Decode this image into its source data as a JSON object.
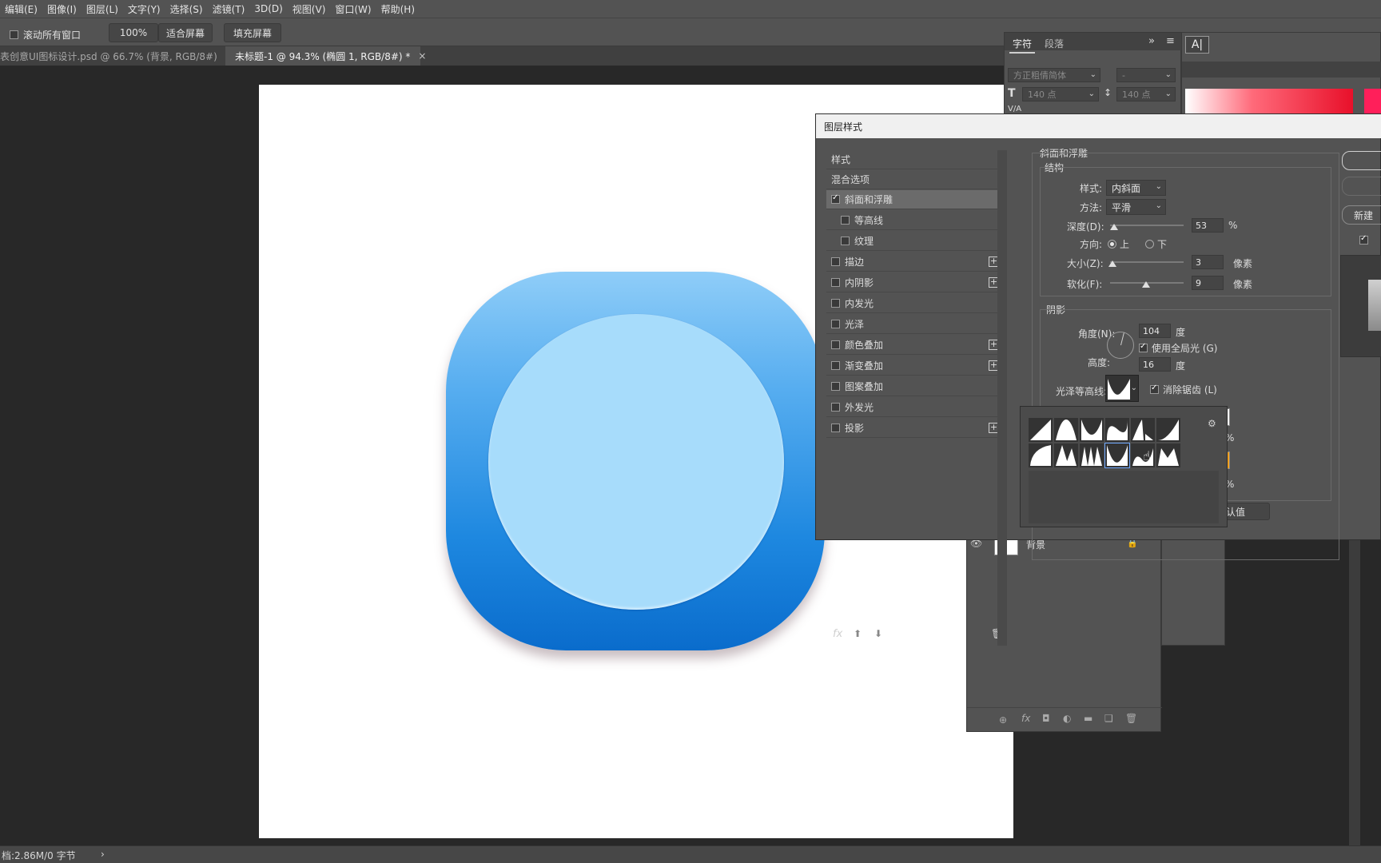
{
  "menu": [
    "编辑(E)",
    "图像(I)",
    "图层(L)",
    "文字(Y)",
    "选择(S)",
    "滤镜(T)",
    "3D(D)",
    "视图(V)",
    "窗口(W)",
    "帮助(H)"
  ],
  "options": {
    "scroll_all_label": "滚动所有窗口",
    "zoom_value": "100%",
    "fit_screen": "适合屏幕",
    "fill_screen": "填充屏幕"
  },
  "tabs": [
    {
      "label": "表创意UI图标设计.psd @ 66.7% (背景, RGB/8#)",
      "close": "×"
    },
    {
      "label": "未标题-1 @ 94.3% (椭圆 1, RGB/8#) *",
      "close": "×"
    }
  ],
  "status": {
    "doc_size": "档:2.86M/0 字节",
    "arrow": "›"
  },
  "char_panel": {
    "tab_char": "字符",
    "tab_para": "段落",
    "expand": "»",
    "menu": "≡",
    "font_family": "方正粗倩简体",
    "font_style": "-",
    "font_size": "140 点",
    "leading": "140 点",
    "kerning_label": "V/A"
  },
  "layers_panel": {
    "bg_layer_name": "背景",
    "footer_icons": [
      "link-icon",
      "fx-icon",
      "mask-icon",
      "adjustment-icon",
      "folder-icon",
      "new-layer-icon",
      "trash-icon"
    ]
  },
  "dialog": {
    "title": "图层样式",
    "styles_header": "样式",
    "blend_options": "混合选项",
    "style_items": [
      {
        "label": "斜面和浮雕",
        "checked": true,
        "selected": true,
        "plus": false,
        "indent": false
      },
      {
        "label": "等高线",
        "checked": false,
        "selected": false,
        "plus": false,
        "indent": true
      },
      {
        "label": "纹理",
        "checked": false,
        "selected": false,
        "plus": false,
        "indent": true
      },
      {
        "label": "描边",
        "checked": false,
        "selected": false,
        "plus": true,
        "indent": false
      },
      {
        "label": "内阴影",
        "checked": false,
        "selected": false,
        "plus": true,
        "indent": false
      },
      {
        "label": "内发光",
        "checked": false,
        "selected": false,
        "plus": false,
        "indent": false
      },
      {
        "label": "光泽",
        "checked": false,
        "selected": false,
        "plus": false,
        "indent": false
      },
      {
        "label": "颜色叠加",
        "checked": false,
        "selected": false,
        "plus": true,
        "indent": false
      },
      {
        "label": "渐变叠加",
        "checked": false,
        "selected": false,
        "plus": true,
        "indent": false
      },
      {
        "label": "图案叠加",
        "checked": false,
        "selected": false,
        "plus": false,
        "indent": false
      },
      {
        "label": "外发光",
        "checked": false,
        "selected": false,
        "plus": false,
        "indent": false
      },
      {
        "label": "投影",
        "checked": false,
        "selected": false,
        "plus": true,
        "indent": false
      }
    ],
    "fx_label": "fx",
    "bevel": {
      "section_title": "斜面和浮雕",
      "structure_title": "结构",
      "style_label": "样式:",
      "style_value": "内斜面",
      "technique_label": "方法:",
      "technique_value": "平滑",
      "depth_label": "深度(D):",
      "depth_value": "53",
      "depth_unit": "%",
      "depth_fraction": 0.05,
      "direction_label": "方向:",
      "dir_up": "上",
      "dir_down": "下",
      "size_label": "大小(Z):",
      "size_value": "3",
      "size_unit": "像素",
      "soften_label": "软化(F):",
      "soften_value": "9",
      "soften_unit": "像素",
      "shading_title": "阴影",
      "angle_label": "角度(N):",
      "angle_value": "104",
      "angle_unit": "度",
      "global_light": "使用全局光 (G)",
      "altitude_label": "高度:",
      "altitude_value": "16",
      "altitude_unit": "度",
      "gloss_label": "光泽等高线:",
      "antialias": "消除锯齿 (L)",
      "pct1": "%",
      "pct2": "%",
      "default_btn": "认值"
    },
    "right_buttons": {
      "new_style": "新建"
    }
  },
  "colors": {
    "ui_bg": "#535353",
    "canvas_bg": "#ffffff",
    "icon_top": "#8fcdf8",
    "icon_bottom": "#0a6ccc",
    "circle": "#a7dcfb",
    "orange_swatch": "#f0a020"
  }
}
